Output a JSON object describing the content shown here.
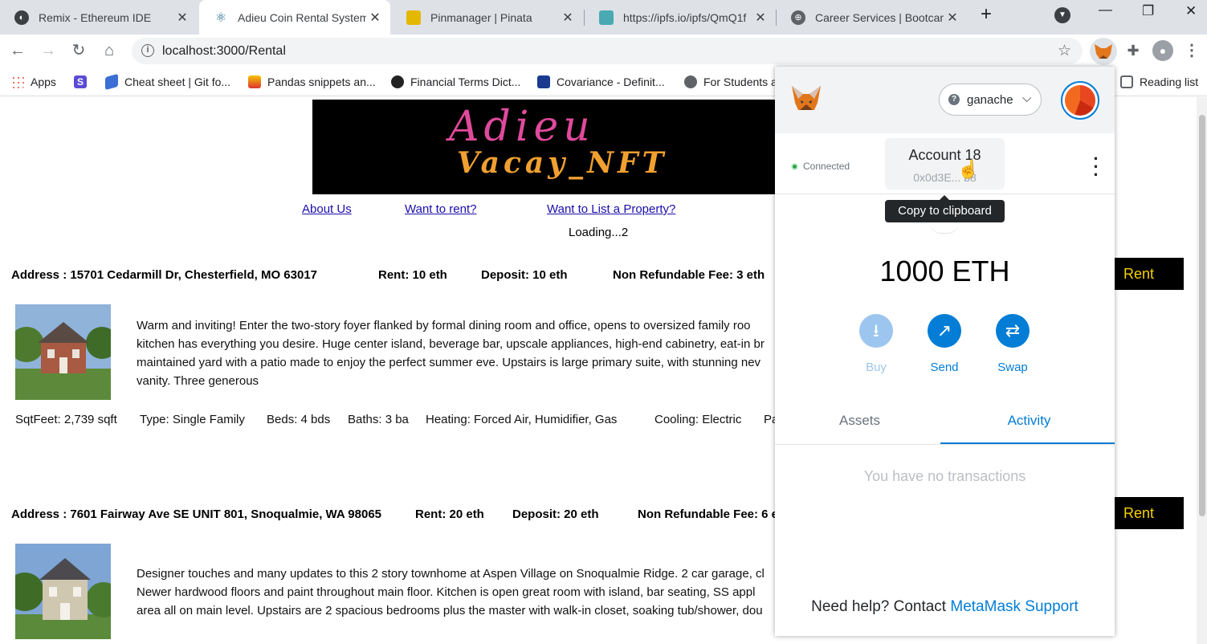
{
  "tabs": [
    {
      "title": "Remix - Ethereum IDE",
      "icon": "remix-icon",
      "color": "#3c4043"
    },
    {
      "title": "Adieu Coin Rental Systems",
      "icon": "react-icon",
      "color": "#1f6a8a"
    },
    {
      "title": "Pinmanager | Pinata",
      "icon": "pinata-icon",
      "color": "#e5b800"
    },
    {
      "title": "https://ipfs.io/ipfs/QmQ1f",
      "icon": "ipfs-cube-icon",
      "color": "#4aa9b2"
    },
    {
      "title": "Career Services | Bootcamp",
      "icon": "globe-icon",
      "color": "#5f6368"
    }
  ],
  "toolbar": {
    "url": "localhost:3000/Rental"
  },
  "bookmarks": [
    {
      "label": "Apps",
      "icon": "apps-grid-icon"
    },
    {
      "label": "",
      "icon": "s-bookmark-icon"
    },
    {
      "label": "Cheat sheet | Git fo...",
      "icon": "cheat-sheet-icon"
    },
    {
      "label": "Pandas snippets an...",
      "icon": "pandas-icon"
    },
    {
      "label": "Financial Terms Dict...",
      "icon": "investopedia-icon"
    },
    {
      "label": "Covariance - Definit...",
      "icon": "covariance-icon"
    },
    {
      "label": "For Students a",
      "icon": "globe-icon"
    },
    {
      "label": "Reading list",
      "icon": "reading-list-icon"
    }
  ],
  "page": {
    "banner": {
      "line1": "Adieu",
      "line2": "Vacay_NFT"
    },
    "links": [
      "About Us",
      "Want to rent?",
      "Want to List a Property?"
    ],
    "loading": "Loading...2",
    "properties": [
      {
        "address": "Address : 15701 Cedarmill Dr, Chesterfield, MO 63017",
        "rent": "Rent: 10 eth",
        "deposit": "Deposit: 10 eth",
        "fee": "Non Refundable Fee: 3 eth",
        "rent_button": "Rent",
        "desc": [
          "Warm and inviting! Enter the two-story foyer flanked by formal dining room and office, opens to oversized family roo",
          "kitchen has everything you desire. Huge center island, beverage bar, upscale appliances, high-end cabinetry, eat-in br",
          "maintained yard with a patio made to enjoy the perfect summer eve. Upstairs is large primary suite, with stunning nev",
          "vanity. Three generous"
        ],
        "facts": [
          "SqtFeet: 2,739 sqft",
          "Type: Single Family",
          "Beds: 4 bds",
          "Baths: 3 ba",
          "Heating: Forced Air, Humidifier, Gas",
          "Cooling: Electric",
          "Pa"
        ]
      },
      {
        "address": "Address : 7601 Fairway Ave SE UNIT 801, Snoqualmie, WA 98065",
        "rent": "Rent: 20 eth",
        "deposit": "Deposit: 20 eth",
        "fee": "Non Refundable Fee: 6 e",
        "rent_button": "Rent",
        "desc": [
          "Designer touches and many updates to this 2 story townhome at Aspen Village on Snoqualmie Ridge. 2 car garage, cl",
          "Newer hardwood floors and paint throughout main floor. Kitchen is open great room with island, bar seating, SS appl",
          "area all on main level. Upstairs are 2 spacious bedrooms plus the master with walk-in closet, soaking tub/shower, dou"
        ]
      }
    ]
  },
  "metamask": {
    "network": "ganache",
    "connected": "Connected",
    "account_name": "Account 18",
    "account_addr": "0x0d3E...  b8",
    "tooltip": "Copy to clipboard",
    "balance": "1000 ETH",
    "actions": [
      {
        "label": "Buy",
        "icon": "download-icon"
      },
      {
        "label": "Send",
        "icon": "arrow-up-right-icon"
      },
      {
        "label": "Swap",
        "icon": "swap-icon"
      }
    ],
    "tabs": [
      "Assets",
      "Activity"
    ],
    "active_tab": "Activity",
    "empty": "You have no transactions",
    "help_prefix": "Need help? Contact",
    "help_link": "MetaMask Support",
    "accent": "#037dd6"
  }
}
